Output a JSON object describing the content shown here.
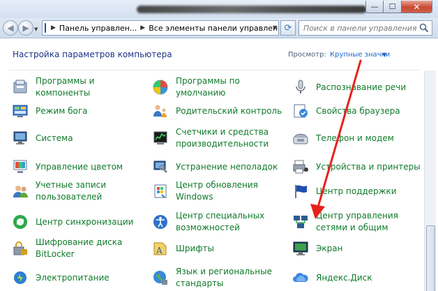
{
  "window": {
    "minimize_glyph": "—",
    "maximize_glyph": "☐",
    "close_glyph": "✕"
  },
  "nav": {
    "back_glyph": "◀",
    "forward_glyph": "▶",
    "breadcrumb": [
      "Панель управлен...",
      "Все элементы панели управления"
    ],
    "refresh_glyph": "⟳",
    "search_placeholder": "Поиск в панели управления"
  },
  "content": {
    "heading": "Настройка параметров компьютера",
    "view_label": "Просмотр:",
    "view_value": "Крупные значки",
    "view_arrow": "▼"
  },
  "items": {
    "c1": [
      {
        "label": "Программы и\nкомпоненты",
        "icon": "programs-icon"
      },
      {
        "label": "Режим бога",
        "icon": "god-mode-icon"
      },
      {
        "label": "Система",
        "icon": "system-icon"
      },
      {
        "label": "Управление цветом",
        "icon": "color-management-icon"
      },
      {
        "label": "Учетные записи\nпользователей",
        "icon": "user-accounts-icon"
      },
      {
        "label": "Центр синхронизации",
        "icon": "sync-center-icon"
      },
      {
        "label": "Шифрование диска\nBitLocker",
        "icon": "bitlocker-icon"
      },
      {
        "label": "Электропитание",
        "icon": "power-options-icon"
      }
    ],
    "c2": [
      {
        "label": "Программы по\nумолчанию",
        "icon": "default-programs-icon"
      },
      {
        "label": "Родительский контроль",
        "icon": "parental-controls-icon"
      },
      {
        "label": "Счетчики и средства\nпроизводительности",
        "icon": "performance-icon"
      },
      {
        "label": "Устранение неполадок",
        "icon": "troubleshooting-icon"
      },
      {
        "label": "Центр обновления\nWindows",
        "icon": "windows-update-icon"
      },
      {
        "label": "Центр специальных\nвозможностей",
        "icon": "ease-of-access-icon"
      },
      {
        "label": "Шрифты",
        "icon": "fonts-icon"
      },
      {
        "label": "Язык и региональные\nстандарты",
        "icon": "region-language-icon"
      }
    ],
    "c3": [
      {
        "label": "Распознавание речи",
        "icon": "speech-recognition-icon"
      },
      {
        "label": "Свойства браузера",
        "icon": "internet-options-icon"
      },
      {
        "label": "Телефон и модем",
        "icon": "phone-modem-icon"
      },
      {
        "label": "Устройства и принтеры",
        "icon": "devices-printers-icon"
      },
      {
        "label": "Центр поддержки",
        "icon": "action-center-icon"
      },
      {
        "label": "Центр управления\nсетями и общим",
        "icon": "network-center-icon"
      },
      {
        "label": "Экран",
        "icon": "display-icon"
      },
      {
        "label": "Яндекс.Диск",
        "icon": "yandex-disk-icon"
      }
    ]
  },
  "colors": {
    "item_text": "#0f7a2a",
    "heading": "#1e3287",
    "link": "#1f64c5",
    "arrow": "#e8211b"
  }
}
